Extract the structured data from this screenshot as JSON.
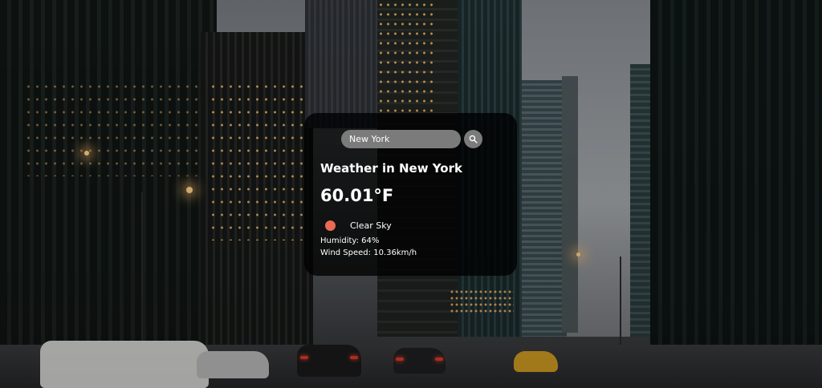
{
  "search": {
    "value": "New York",
    "placeholder": "Search"
  },
  "weather": {
    "title": "Weather in New York",
    "temperature": "60.01°F",
    "condition": "Clear Sky",
    "condition_icon": "sun-icon",
    "humidity": "Humidity: 64%",
    "wind": "Wind Speed: 10.36km/h"
  },
  "colors": {
    "card_background": "rgba(0,0,0,0.78)",
    "input_background": "#7b7b7b",
    "condition_icon": "#ec6a52",
    "text": "#ffffff"
  },
  "background": {
    "description_icon": "city-street-background"
  }
}
